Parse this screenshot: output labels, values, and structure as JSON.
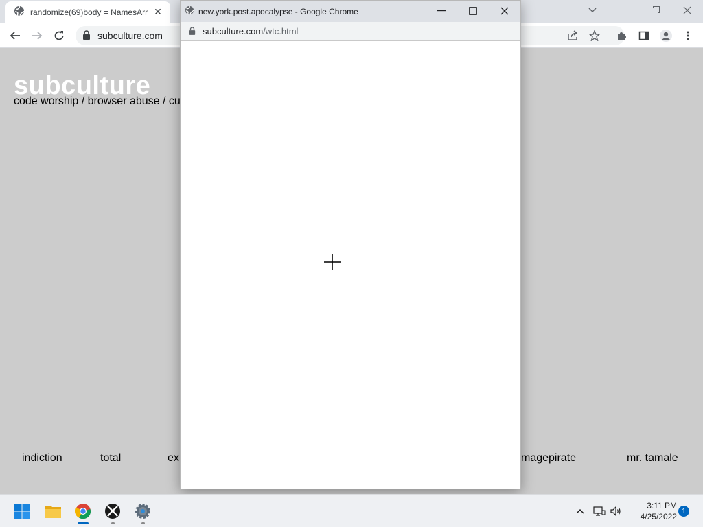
{
  "browser": {
    "tab": {
      "title": "randomize(69)body = NamesArr",
      "close": "✕"
    },
    "omnibox": {
      "url": "subculture.com"
    },
    "window_controls": {
      "dropdown": "⌄",
      "minimize": "—",
      "restore": "❐",
      "close": "✕"
    }
  },
  "page": {
    "title": "subculture",
    "tagline": "code worship / browser abuse / cu",
    "bottom_links": [
      "indiction",
      "total",
      "ex",
      "magepirate",
      "mr. tamale"
    ]
  },
  "popup": {
    "title": "new.york.post.apocalypse - Google Chrome",
    "url_host": "subculture.com",
    "url_path": "/wtc.html"
  },
  "taskbar": {
    "time": "3:11 PM",
    "date": "4/25/2022",
    "notification_count": "1",
    "apps": [
      "start-icon",
      "file-explorer-icon",
      "chrome-icon",
      "xbox-icon",
      "settings-icon"
    ]
  }
}
